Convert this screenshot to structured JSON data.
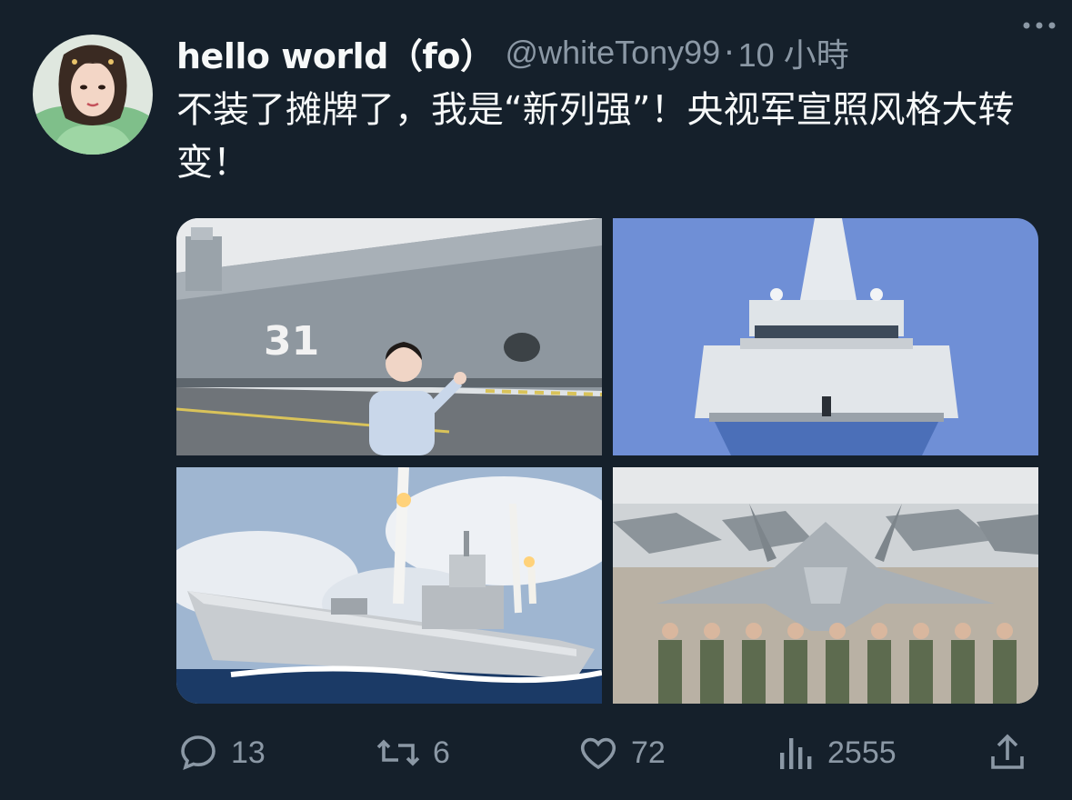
{
  "tweet": {
    "display_name": "hello world（fo）",
    "handle": "@whiteTony99",
    "separator": "·",
    "time": "10 小時",
    "text": "不装了摊牌了，我是“新列强”！央视军宣照风格大转变！"
  },
  "actions": {
    "reply_count": "13",
    "retweet_count": "6",
    "like_count": "72",
    "views_count": "2555"
  },
  "media": [
    {
      "name": "aircraft-carrier-with-reporter",
      "hull_number": "31"
    },
    {
      "name": "destroyer-bow-view"
    },
    {
      "name": "destroyer-missile-launch"
    },
    {
      "name": "fighter-jets-with-pilots-saluting"
    }
  ],
  "colors": {
    "background": "#15202b",
    "text_primary": "#f7f9f9",
    "text_secondary": "#8b98a5"
  },
  "icons": [
    "reply-icon",
    "retweet-icon",
    "like-icon",
    "views-icon",
    "share-icon",
    "more-icon"
  ]
}
